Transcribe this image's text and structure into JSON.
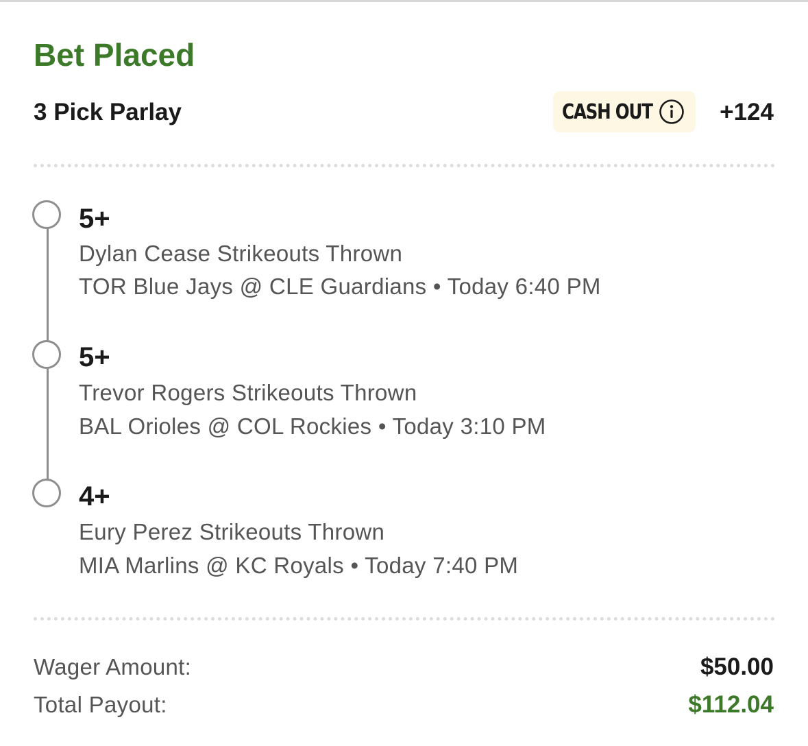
{
  "header": {
    "title": "Bet Placed",
    "bet_type": "3 Pick Parlay",
    "cash_out_label": "CASH OUT",
    "odds": "+124"
  },
  "legs": [
    {
      "pick": "5+",
      "market": "Dylan Cease Strikeouts Thrown",
      "game": "TOR Blue Jays @ CLE Guardians • Today 6:40 PM"
    },
    {
      "pick": "5+",
      "market": "Trevor Rogers Strikeouts Thrown",
      "game": "BAL Orioles @ COL Rockies • Today 3:10 PM"
    },
    {
      "pick": "4+",
      "market": "Eury Perez Strikeouts Thrown",
      "game": "MIA Marlins @ KC Royals • Today 7:40 PM"
    }
  ],
  "summary": {
    "wager_label": "Wager Amount:",
    "wager_value": "$50.00",
    "payout_label": "Total Payout:",
    "payout_value": "$112.04"
  },
  "colors": {
    "accent_green": "#3c7a2a",
    "payout_green": "#3c7a2a",
    "cash_out_bg": "#fdf7e3",
    "timeline_gray": "#8e8e8e",
    "secondary_text": "#555555"
  },
  "icons": {
    "cash_out_info": "info-circle-icon",
    "leg_status": "empty-circle-icon"
  }
}
